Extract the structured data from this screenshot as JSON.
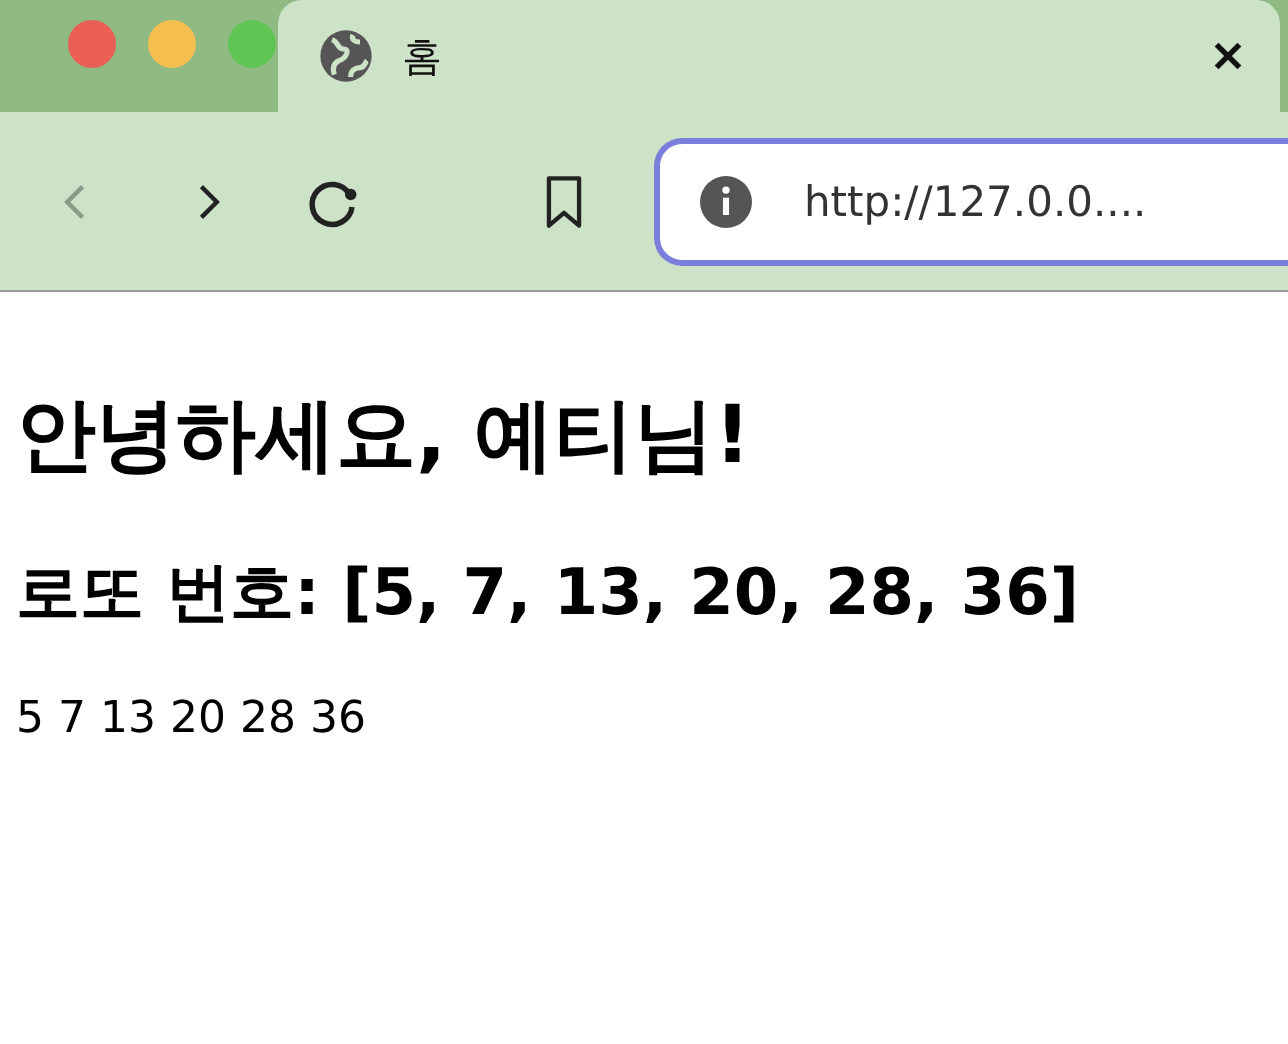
{
  "window": {
    "controls": [
      {
        "color": "#ec5f57"
      },
      {
        "color": "#f4bf4f"
      },
      {
        "color": "#61c554"
      }
    ]
  },
  "tabs": [
    {
      "title": "홈",
      "selected": true
    }
  ],
  "toolbar": {
    "back_disabled": true,
    "forward_disabled": false,
    "address": "http://127.0.0...."
  },
  "page": {
    "heading": "안녕하세요, 예티님!",
    "subheading": "로또 번호: [5, 7, 13, 20, 28, 36]",
    "numbers": "5 7 13 20 28 36"
  }
}
